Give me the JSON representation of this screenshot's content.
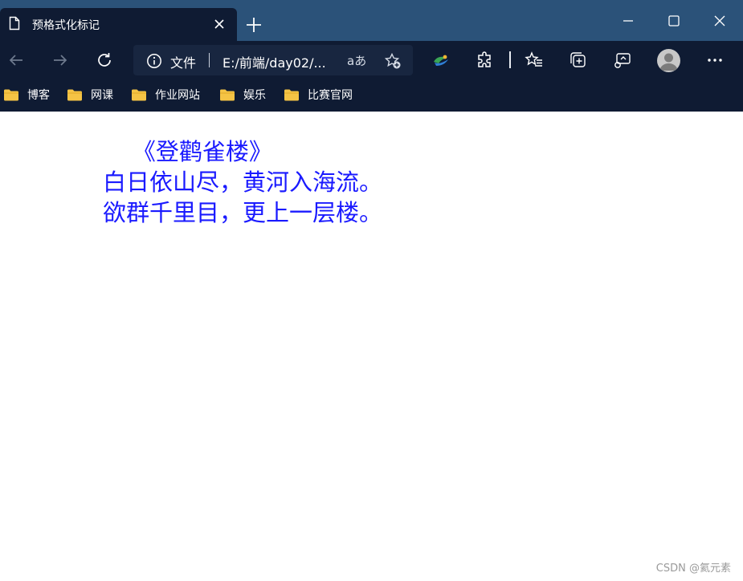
{
  "tab": {
    "title": "预格式化标记",
    "icon": "page-icon"
  },
  "toolbar": {
    "back_icon": "back-arrow-icon",
    "forward_icon": "forward-arrow-icon",
    "refresh_icon": "refresh-icon",
    "address": {
      "info_icon": "info-icon",
      "scheme_label": "文件",
      "url": "E:/前端/day02/...",
      "read_aloud_label": "aあ"
    }
  },
  "bookmarks": [
    {
      "label": "博客"
    },
    {
      "label": "网课"
    },
    {
      "label": "作业网站"
    },
    {
      "label": "娱乐"
    },
    {
      "label": "比赛官网"
    }
  ],
  "page": {
    "poem_lines": [
      "    《登鹳雀楼》",
      "白日依山尽，黄河入海流。",
      "欲群千里目，更上一层楼。"
    ],
    "text_color": "#1a1aff"
  },
  "watermark": "CSDN @氦元素",
  "colors": {
    "titlebar": "#2b5279",
    "chrome": "#0f1b33",
    "folder": "#f5c445"
  }
}
